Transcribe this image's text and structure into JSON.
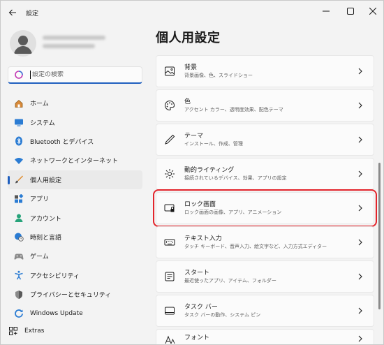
{
  "window": {
    "title": "設定"
  },
  "sidebar": {
    "search": {
      "placeholder": "設定の検索"
    },
    "items": [
      {
        "label": "ホーム",
        "icon": "home-icon"
      },
      {
        "label": "システム",
        "icon": "monitor-icon"
      },
      {
        "label": "Bluetooth とデバイス",
        "icon": "bluetooth-icon"
      },
      {
        "label": "ネットワークとインターネット",
        "icon": "wifi-icon"
      },
      {
        "label": "個人用設定",
        "icon": "brush-icon",
        "active": true
      },
      {
        "label": "アプリ",
        "icon": "apps-icon"
      },
      {
        "label": "アカウント",
        "icon": "person-icon"
      },
      {
        "label": "時刻と言語",
        "icon": "globe-clock-icon"
      },
      {
        "label": "ゲーム",
        "icon": "gamepad-icon"
      },
      {
        "label": "アクセシビリティ",
        "icon": "accessibility-icon"
      },
      {
        "label": "プライバシーとセキュリティ",
        "icon": "shield-icon"
      },
      {
        "label": "Windows Update",
        "icon": "update-icon"
      }
    ],
    "extras": {
      "label": "Extras",
      "icon": "extras-icon"
    }
  },
  "main": {
    "title": "個人用設定",
    "cards": [
      {
        "title": "背景",
        "subtitle": "背景画像、色、スライドショー",
        "icon": "image-icon"
      },
      {
        "title": "色",
        "subtitle": "アクセント カラー、透明度効果、配色テーマ",
        "icon": "palette-icon"
      },
      {
        "title": "テーマ",
        "subtitle": "インストール、作成、管理",
        "icon": "pen-icon"
      },
      {
        "title": "動的ライティング",
        "subtitle": "接続されているデバイス、効果、アプリの設定",
        "icon": "lighting-icon"
      },
      {
        "title": "ロック画面",
        "subtitle": "ロック画面の画像、アプリ、アニメーション",
        "icon": "lock-screen-icon",
        "highlighted": true
      },
      {
        "title": "テキスト入力",
        "subtitle": "タッチ キーボード、音声入力、絵文字など、入力方式エディター",
        "icon": "keyboard-icon"
      },
      {
        "title": "スタート",
        "subtitle": "最近使ったアプリ、アイテム、フォルダー",
        "icon": "start-icon"
      },
      {
        "title": "タスク バー",
        "subtitle": "タスク バーの動作、システム ピン",
        "icon": "taskbar-icon"
      },
      {
        "title": "フォント",
        "subtitle": "",
        "icon": "font-icon"
      }
    ]
  },
  "colors": {
    "accent": "#1f5fbf",
    "highlight_box": "#e3242b"
  }
}
